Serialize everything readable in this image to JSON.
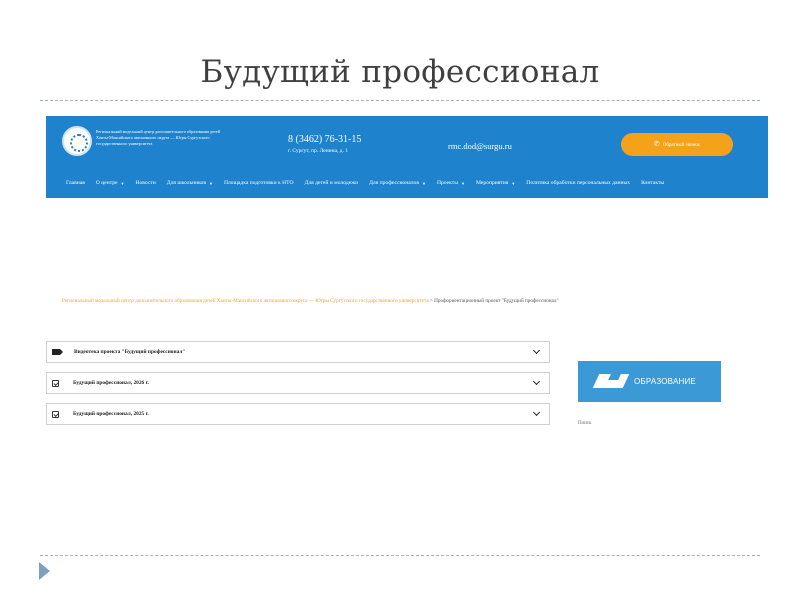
{
  "slide": {
    "title": "Будущий профессионал"
  },
  "site": {
    "org_name": "Региональный модельный центр дополнительного образования детей Ханты-Мансийского автономного округа — Югры Сургутского государственного университета",
    "phone": "8 (3462) 76-31-15",
    "address": "г. Сургут, пр. Ленина, д. 1",
    "email": "rmc.dod@surgu.ru",
    "cta_label": "Обратный звонок",
    "cta_icon": "phone-icon"
  },
  "nav": {
    "items": [
      {
        "label": "Главная",
        "dropdown": false
      },
      {
        "label": "О центре",
        "dropdown": true
      },
      {
        "label": "Новости",
        "dropdown": false
      },
      {
        "label": "Для школьников",
        "dropdown": true
      },
      {
        "label": "Площадка подготовки к НТО",
        "dropdown": false
      },
      {
        "label": "Для детей и молодежи",
        "dropdown": false
      },
      {
        "label": "Для профессионалов",
        "dropdown": true
      },
      {
        "label": "Проекты",
        "dropdown": true
      },
      {
        "label": "Мероприятия",
        "dropdown": true
      },
      {
        "label": "Политика обработки персональных данных",
        "dropdown": false
      },
      {
        "label": "Контакты",
        "dropdown": false
      }
    ]
  },
  "breadcrumb": {
    "link": "Региональный модельный центр дополнительного образования детей Ханты-Мансийского автономного округа — Югры Сургутского государственного университета",
    "separator": ">",
    "current": "Профориентационный проект \"Будущий профессионал\""
  },
  "accordion": [
    {
      "label": "Видеотека проекта \"Будущий профессионал\"",
      "icon": "video-icon"
    },
    {
      "label": "Будущий профессионал, 2026 г.",
      "icon": "calendar-icon"
    },
    {
      "label": "Будущий профессионал, 2025 г.",
      "icon": "calendar-icon"
    }
  ],
  "sidebar": {
    "banner_text": "ОБРАЗОВАНИЕ",
    "label": "Поиск"
  },
  "colors": {
    "header_blue": "#1e82cd",
    "cta_orange": "#f5a21b",
    "banner_blue": "#3b9ad6",
    "breadcrumb_orange": "#f0a23a"
  }
}
